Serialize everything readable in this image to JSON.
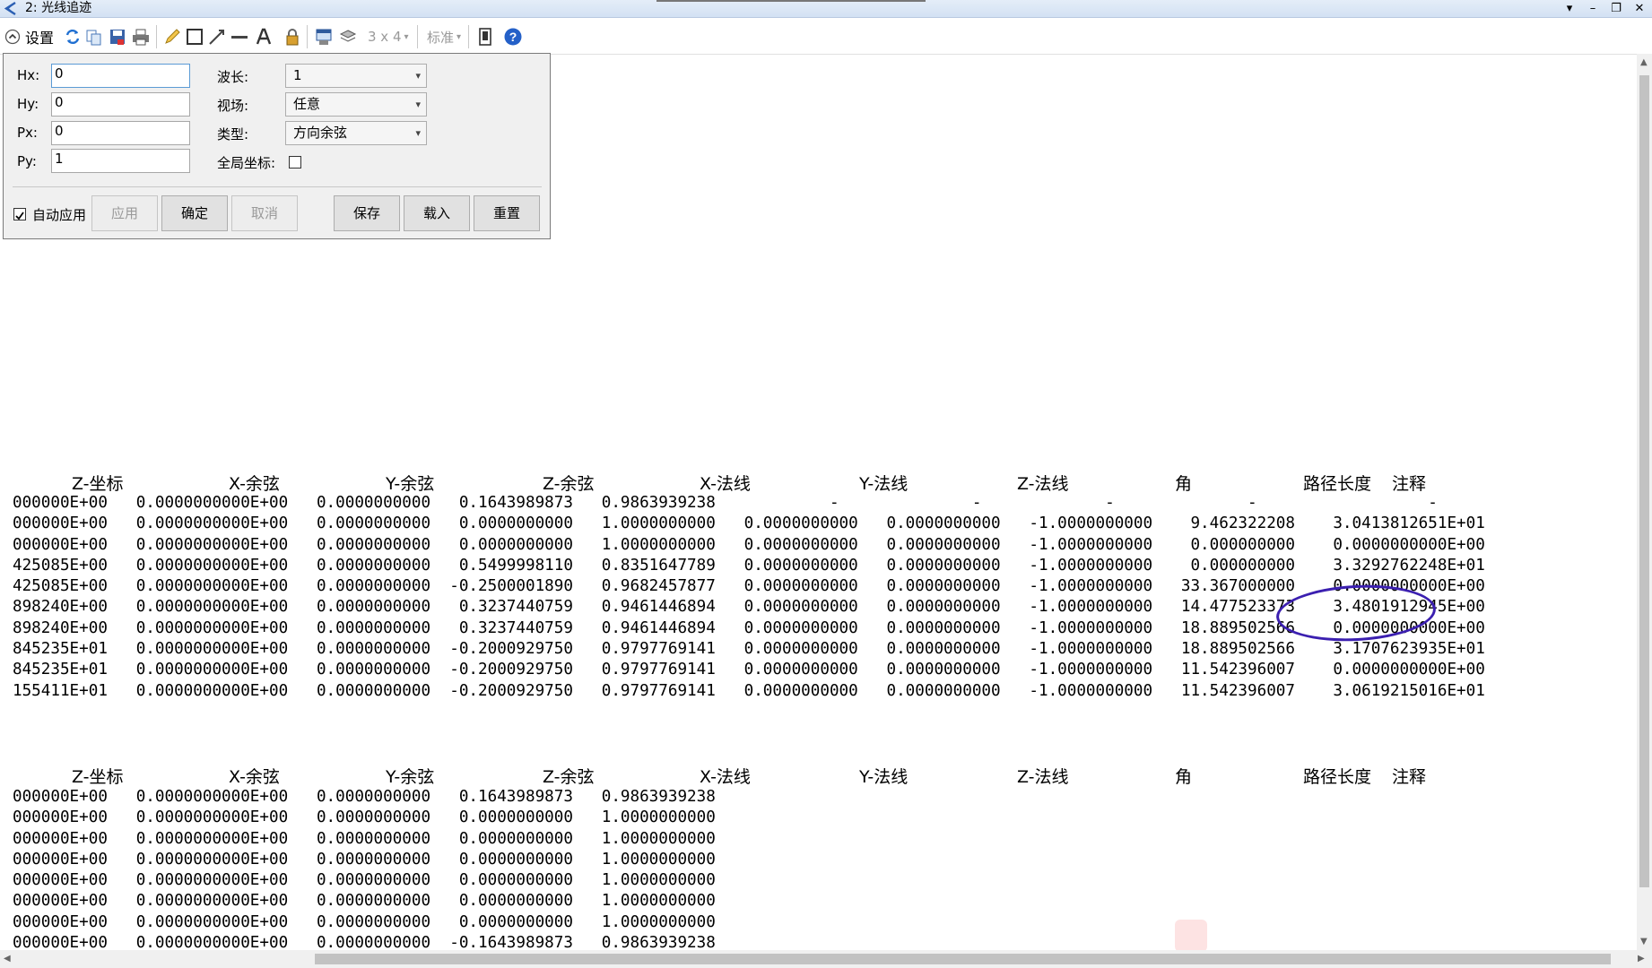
{
  "window": {
    "title": "2: 光线追迹",
    "controls": [
      "▾",
      "–",
      "❐",
      "✕"
    ]
  },
  "toolbar": {
    "settings_label": "设置",
    "layout_label": "3 x 4",
    "standard_label": "标准",
    "dropdown_mark": "▾"
  },
  "settings": {
    "hx_label": "Hx:",
    "hx_value": "0",
    "hy_label": "Hy:",
    "hy_value": "0",
    "px_label": "Px:",
    "px_value": "0",
    "py_label": "Py:",
    "py_value": "1",
    "wavelength_label": "波长:",
    "wavelength_value": "1",
    "field_label": "视场:",
    "field_value": "任意",
    "type_label": "类型:",
    "type_value": "方向余弦",
    "global_label": "全局坐标:",
    "auto_apply_label": "自动应用",
    "auto_apply_checked": true,
    "global_checked": false,
    "buttons": {
      "apply": "应用",
      "ok": "确定",
      "cancel": "取消",
      "save": "保存",
      "load": "载入",
      "reset": "重置"
    }
  },
  "table1": {
    "headers": [
      "Z-坐标",
      "X-余弦",
      "Y-余弦",
      "Z-余弦",
      "X-法线",
      "Y-法线",
      "Z-法线",
      "角",
      "路径长度",
      "注释"
    ],
    "rows": [
      "000000E+00   0.0000000000E+00   0.0000000000   0.1643989873   0.9863939238            -              -             -              -                  -",
      "000000E+00   0.0000000000E+00   0.0000000000   0.0000000000   1.0000000000   0.0000000000   0.0000000000   -1.0000000000    9.462322208    3.0413812651E+01",
      "000000E+00   0.0000000000E+00   0.0000000000   0.0000000000   1.0000000000   0.0000000000   0.0000000000   -1.0000000000    0.000000000    0.0000000000E+00",
      "425085E+00   0.0000000000E+00   0.0000000000   0.5499998110   0.8351647789   0.0000000000   0.0000000000   -1.0000000000    0.000000000    3.3292762248E+01",
      "425085E+00   0.0000000000E+00   0.0000000000  -0.2500001890   0.9682457877   0.0000000000   0.0000000000   -1.0000000000   33.367000000    0.0000000000E+00",
      "898240E+00   0.0000000000E+00   0.0000000000   0.3237440759   0.9461446894   0.0000000000   0.0000000000   -1.0000000000   14.477523373    3.4801912945E+00",
      "898240E+00   0.0000000000E+00   0.0000000000   0.3237440759   0.9461446894   0.0000000000   0.0000000000   -1.0000000000   18.889502566    0.0000000000E+00",
      "845235E+01   0.0000000000E+00   0.0000000000  -0.2000929750   0.9797769141   0.0000000000   0.0000000000   -1.0000000000   18.889502566    3.1707623935E+01",
      "845235E+01   0.0000000000E+00   0.0000000000  -0.2000929750   0.9797769141   0.0000000000   0.0000000000   -1.0000000000   11.542396007    0.0000000000E+00",
      "155411E+01   0.0000000000E+00   0.0000000000  -0.2000929750   0.9797769141   0.0000000000   0.0000000000   -1.0000000000   11.542396007    3.0619215016E+01"
    ]
  },
  "table2": {
    "headers": [
      "Z-坐标",
      "X-余弦",
      "Y-余弦",
      "Z-余弦",
      "X-法线",
      "Y-法线",
      "Z-法线",
      "角",
      "路径长度",
      "注释"
    ],
    "rows": [
      "000000E+00   0.0000000000E+00   0.0000000000   0.1643989873   0.9863939238",
      "000000E+00   0.0000000000E+00   0.0000000000   0.0000000000   1.0000000000",
      "000000E+00   0.0000000000E+00   0.0000000000   0.0000000000   1.0000000000",
      "000000E+00   0.0000000000E+00   0.0000000000   0.0000000000   1.0000000000",
      "000000E+00   0.0000000000E+00   0.0000000000   0.0000000000   1.0000000000",
      "000000E+00   0.0000000000E+00   0.0000000000   0.0000000000   1.0000000000",
      "000000E+00   0.0000000000E+00   0.0000000000   0.0000000000   1.0000000000",
      "000000E+00   0.0000000000E+00   0.0000000000  -0.1643989873   0.9863939238"
    ]
  },
  "colors": {
    "annotation_circle": "#3b1fb0",
    "toolbar_blue": "#1f5fbf"
  }
}
